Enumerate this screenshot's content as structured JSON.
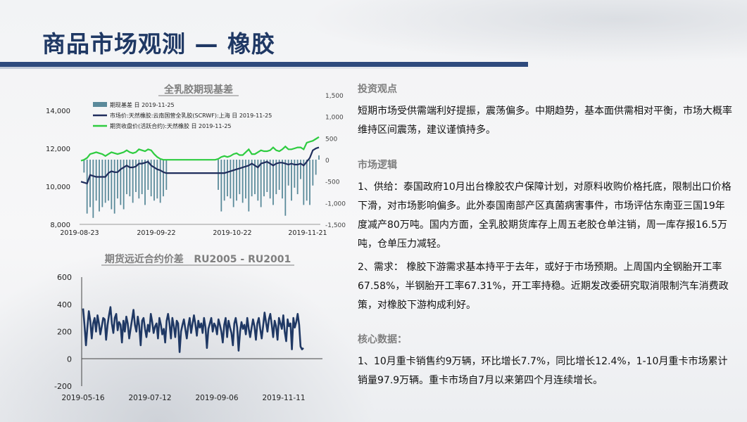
{
  "page": {
    "title": "商品市场观测 — 橡胶"
  },
  "chart_data": [
    {
      "type": "line",
      "title": "全乳胶期现基差",
      "x_ticks": [
        "2019-08-23",
        "2019-09-22",
        "2019-10-22",
        "2019-11-21"
      ],
      "y_left_ticks": [
        "14,000",
        "12,000",
        "10,000",
        "8,000"
      ],
      "y_left_range": [
        8000,
        14000
      ],
      "y_right_ticks": [
        "1,500",
        "1,000",
        "500",
        "0",
        "-500",
        "-1,000",
        "-1,500"
      ],
      "y_right_range": [
        -1500,
        1500
      ],
      "grid": false,
      "legend_position": "top-left",
      "series": [
        {
          "name": "期现基差 日 2019-11-25",
          "kind": "bar",
          "axis": "right",
          "color": "#5a8a9a",
          "values": [
            0,
            -300,
            -1250,
            -1100,
            -1350,
            -950,
            -1200,
            -1100,
            -1000,
            -950,
            -1150,
            -1250,
            -900,
            -1050,
            -1150,
            -800,
            -850,
            -1000,
            -750,
            -900,
            -800,
            -1050,
            -700,
            -850,
            -950,
            -900,
            -1000,
            -850,
            -700,
            0,
            0,
            0,
            0,
            0,
            0,
            0,
            0,
            0,
            0,
            0,
            0,
            0,
            0,
            0,
            0,
            -700,
            -1200,
            -950,
            -850,
            -900,
            -1100,
            -950,
            -800,
            -1000,
            -900,
            -1200,
            -850,
            -800,
            -950,
            -1100,
            -850,
            -750,
            -900,
            -1050,
            -800,
            -700,
            -900,
            -1300,
            -600,
            -950,
            -650,
            -800,
            -450,
            -1050,
            -950,
            -1050,
            -600,
            -350,
            100
          ]
        },
        {
          "name": "市场价:天然橡胶:云南国营全乳胶(SCRWF):上海 日 2019-11-25",
          "kind": "line",
          "axis": "left",
          "color": "#1f2d5c",
          "values": [
            10250,
            10200,
            10150,
            10600,
            10550,
            10500,
            10500,
            10500,
            10500,
            10700,
            10800,
            10750,
            10750,
            10900,
            11000,
            11100,
            11000,
            11000,
            11050,
            11200,
            11200,
            11250,
            11300,
            11100,
            11000,
            10900,
            10850,
            10750,
            10700,
            10700,
            10700,
            10700,
            10700,
            10700,
            10700,
            10700,
            10700,
            10700,
            10700,
            10700,
            10700,
            10700,
            10700,
            10700,
            10700,
            10700,
            10700,
            10700,
            10750,
            10800,
            10850,
            10900,
            10950,
            11000,
            11050,
            11100,
            11200,
            11100,
            11000,
            11200,
            11250,
            11300,
            11200,
            11100,
            11200,
            11250,
            11250,
            11200,
            11150,
            11200,
            11150,
            11150,
            11200,
            11100,
            11300,
            11500,
            11900,
            12000,
            12050
          ]
        },
        {
          "name": "期货收盘价(活跃合约):天然橡胶 日 2019-11-25",
          "kind": "line",
          "axis": "left",
          "color": "#2ecc40",
          "values": [
            11350,
            11400,
            11500,
            11700,
            11750,
            11800,
            11750,
            11700,
            11600,
            11700,
            11800,
            11750,
            11700,
            11750,
            11800,
            11900,
            11800,
            11750,
            11800,
            11950,
            11900,
            11850,
            11950,
            11900,
            11700,
            11550,
            11450,
            11400,
            11400,
            11400,
            11400,
            11400,
            11400,
            11400,
            11400,
            11400,
            11400,
            11400,
            11400,
            11400,
            11400,
            11400,
            11400,
            11400,
            11400,
            11450,
            11550,
            11600,
            11550,
            11600,
            11700,
            11750,
            11650,
            11650,
            11800,
            11950,
            11700,
            11700,
            11800,
            11900,
            11850,
            11850,
            11900,
            12050,
            11900,
            11850,
            11950,
            12100,
            11950,
            11950,
            12000,
            12050,
            12050,
            11950,
            12300,
            12350,
            12400,
            12500,
            12600
          ]
        }
      ]
    },
    {
      "type": "line",
      "title": "期货远近合约价差   RU2005 - RU2001",
      "x_ticks": [
        "2019-05-16",
        "2019-07-12",
        "2019-09-06",
        "2019-11-11"
      ],
      "y_ticks": [
        "600",
        "400",
        "200",
        "0",
        "-200"
      ],
      "y_range": [
        -200,
        600
      ],
      "grid": false,
      "series": [
        {
          "name": "",
          "color": "#1f3864",
          "values": [
            370,
            250,
            100,
            230,
            350,
            280,
            150,
            260,
            300,
            200,
            320,
            260,
            180,
            240,
            300,
            290,
            140,
            250,
            320,
            380,
            260,
            190,
            300,
            330,
            210,
            270,
            250,
            120,
            280,
            200,
            310,
            260,
            150,
            220,
            290,
            360,
            250,
            200,
            310,
            240,
            100,
            280,
            300,
            220,
            160,
            250,
            200,
            330,
            270,
            190,
            240,
            260,
            150,
            300,
            250,
            180,
            220,
            120,
            280,
            330,
            260,
            150,
            300,
            240,
            160,
            280,
            260,
            50,
            200,
            250,
            290,
            220,
            150,
            240,
            300,
            190,
            260,
            320,
            250,
            170,
            280,
            230,
            260,
            190,
            300,
            230,
            80,
            220,
            260,
            300,
            200,
            260,
            240,
            180,
            290,
            250,
            200,
            120,
            250,
            300,
            160,
            280,
            230,
            190,
            100,
            260,
            300,
            230,
            60,
            200,
            270,
            220,
            250,
            180,
            300,
            220,
            160,
            230,
            290,
            240,
            140,
            260,
            300,
            220,
            150,
            240,
            340,
            270,
            200,
            290,
            330,
            250,
            160,
            280,
            240,
            140,
            300,
            260,
            220,
            320,
            200,
            130,
            290,
            240,
            260,
            70,
            300,
            230,
            270,
            330,
            250,
            90,
            70,
            80
          ]
        }
      ]
    }
  ],
  "right": {
    "sections": [
      {
        "heading": "投资观点",
        "paragraphs": [
          "短期市场受供需端利好提振，震荡偏多。中期趋势，基本面供需相对平衡，市场大概率维持区间震荡，建议谨慎持多。"
        ]
      },
      {
        "heading": "市场逻辑",
        "paragraphs": [
          "1、供给：泰国政府10月出台橡胶农户保障计划，对原料收购价格托底，限制出口价格下滑，对市场影响偏多。此外泰国南部产区真菌病害事件，市场评估东南亚三国19年度减产80万吨。国内方面，全乳胶期货库存上周五老胶仓单注销，周一库存报16.5万吨，仓单压力减轻。",
          "2、需求： 橡胶下游需求基本持平于去年，或好于市场预期。上周国内全钢胎开工率67.58%，半钢胎开工率67.31%，开工率持稳。近期发改委研究取消限制汽车消费政策，对橡胶下游构成利好。"
        ]
      },
      {
        "heading": "核心数据：",
        "paragraphs": [
          "1、10月重卡销售约9万辆，环比增长7.7%，同比增长12.4%，1-10月重卡市场累计销量97.9万辆。重卡市场自7月以来第四个月连续增长。"
        ]
      }
    ]
  }
}
